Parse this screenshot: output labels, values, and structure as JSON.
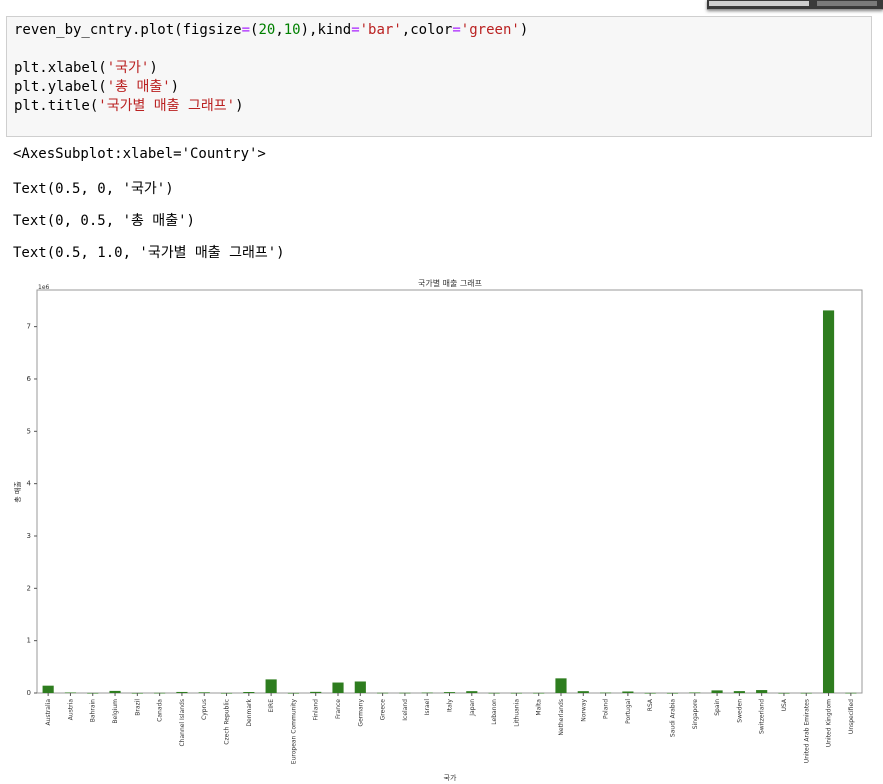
{
  "window_thumb": {
    "icon": "window-thumbnail"
  },
  "code_cell": {
    "line1": {
      "a": "reven_by_cntry.plot(figsize",
      "b": "=",
      "c": "(",
      "d": "20",
      "e": ",",
      "f": "10",
      "g": "),kind",
      "h": "=",
      "i": "'bar'",
      "j": ",color",
      "k": "=",
      "l": "'green'",
      "m": ")"
    },
    "line2": {
      "a": "plt.xlabel(",
      "b": "'국가'",
      "c": ")"
    },
    "line3": {
      "a": "plt.ylabel(",
      "b": "'총 매출'",
      "c": ")"
    },
    "line4": {
      "a": "plt.title(",
      "b": "'국가별 매출 그래프'",
      "c": ")"
    }
  },
  "outputs": [
    "<AxesSubplot:xlabel='Country'>",
    "Text(0.5, 0, '국가')",
    "Text(0, 0.5, '총 매출')",
    "Text(0.5, 1.0, '국가별 매출 그래프')"
  ],
  "chart_data": {
    "type": "bar",
    "title": "국가별 매출 그래프",
    "xlabel": "국가",
    "ylabel": "총 매출",
    "y_scale_label": "1e6",
    "ylim": [
      0,
      7.7
    ],
    "yticks": [
      0,
      1,
      2,
      3,
      4,
      5,
      6,
      7
    ],
    "bar_color": "#2e7d1f",
    "grid": false,
    "categories": [
      "Australia",
      "Austria",
      "Bahrain",
      "Belgium",
      "Brazil",
      "Canada",
      "Channel Islands",
      "Cyprus",
      "Czech Republic",
      "Denmark",
      "EIRE",
      "European Community",
      "Finland",
      "France",
      "Germany",
      "Greece",
      "Iceland",
      "Israel",
      "Italy",
      "Japan",
      "Lebanon",
      "Lithuania",
      "Malta",
      "Netherlands",
      "Norway",
      "Poland",
      "Portugal",
      "RSA",
      "Saudi Arabia",
      "Singapore",
      "Spain",
      "Sweden",
      "Switzerland",
      "USA",
      "United Arab Emirates",
      "United Kingdom",
      "Unspecified"
    ],
    "values": [
      0.14,
      0.01,
      0.001,
      0.04,
      0.001,
      0.003,
      0.02,
      0.013,
      0.001,
      0.019,
      0.26,
      0.001,
      0.022,
      0.2,
      0.22,
      0.004,
      0.004,
      0.008,
      0.017,
      0.035,
      0.002,
      0.002,
      0.002,
      0.28,
      0.035,
      0.007,
      0.029,
      0.001,
      0.001,
      0.01,
      0.05,
      0.036,
      0.056,
      0.001,
      0.002,
      7.31,
      0.003
    ]
  }
}
